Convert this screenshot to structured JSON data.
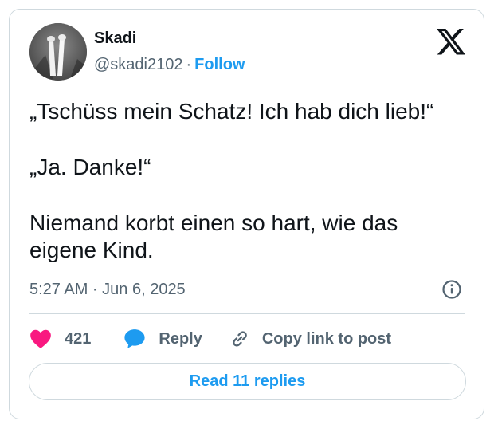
{
  "author": {
    "name": "Skadi",
    "handle": "@skadi2102",
    "separator": "·",
    "follow_label": "Follow"
  },
  "tweet": {
    "paragraphs": [
      "„Tschüss mein Schatz! Ich hab dich lieb!“",
      "„Ja. Danke!“",
      "Niemand korbt einen so hart, wie das eigene Kind."
    ],
    "timestamp": "5:27 AM · Jun 6, 2025"
  },
  "actions": {
    "like_count": "421",
    "reply_label": "Reply",
    "copy_label": "Copy link to post"
  },
  "read_replies_label": "Read 11 replies",
  "icons": {
    "brand": "x-logo-icon",
    "like": "heart-icon",
    "reply": "speech-bubble-icon",
    "copy": "link-icon",
    "info": "info-icon"
  },
  "colors": {
    "accent": "#1d9bf0",
    "like": "#f91880",
    "text": "#0f1419",
    "muted": "#536471",
    "border": "#cfd9de"
  }
}
